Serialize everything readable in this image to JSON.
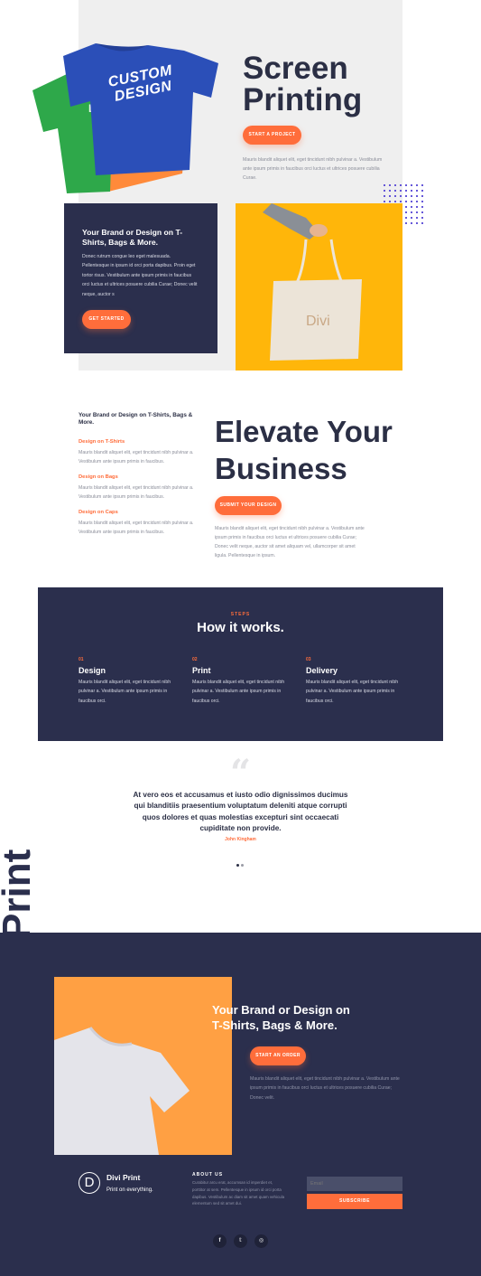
{
  "colors": {
    "navy": "#2b2f4d",
    "orange": "#ff6d3b",
    "yellow": "#ffb60a",
    "amber": "#ffa043",
    "light_gray": "#efefef",
    "purple_dots": "#5a4bd6"
  },
  "hero": {
    "title_line1": "Screen",
    "title_line2": "Printing",
    "button": "START A PROJECT",
    "text": "Mauris blandit aliquet elit, eget tincidunt nibh pulvinar a. Vestibulum ante ipsum primis in faucibus orci luctus et ultrices posuere cubilia Curae.",
    "tshirt_text": "CUSTOM DESIGN",
    "green_shirt_letter": "L"
  },
  "brand_card": {
    "title": "Your Brand or Design on T-Shirts, Bags & More.",
    "text": "Donec rutrum congue leo eget malesuada. Pellentesque in ipsum id orci porta dapibus. Proin eget tortor risus. Vestibulum ante ipsum primis in faucibus orci luctus et ultrices posuere cubilia Curae; Donec velit neque, auctor s",
    "button": "GET STARTED",
    "bag_text": "Divi"
  },
  "elevate": {
    "sidebar_title": "Your Brand or Design on T-Shirts, Bags & More.",
    "items": [
      {
        "title": "Design on T-Shirts",
        "text": "Mauris blandit aliquet elit, eget tincidunt nibh pulvinar a. Vestibulum ante ipsum primis in faucibus."
      },
      {
        "title": "Design on Bags",
        "text": "Mauris blandit aliquet elit, eget tincidunt nibh pulvinar a. Vestibulum ante ipsum primis in faucibus."
      },
      {
        "title": "Design on Caps",
        "text": "Mauris blandit aliquet elit, eget tincidunt nibh pulvinar a. Vestibulum ante ipsum primis in faucibus."
      }
    ],
    "title_line1": "Elevate Your",
    "title_line2": "Business",
    "button": "SUBMIT YOUR DESIGN",
    "text": "Mauris blandit aliquet elit, eget tincidunt nibh pulvinar a. Vestibulum ante ipsum primis in faucibus orci luctus et ultrices posuere cubilia Curae; Donec velit neque, auctor sit amet aliquam vel, ullamcorper sit amet ligula. Pellentesque in ipsum."
  },
  "steps": {
    "eyebrow": "STEPS",
    "title": "How it works.",
    "items": [
      {
        "num": "01",
        "title": "Design",
        "text": "Mauris blandit aliquet elit, eget tincidunt nibh pulvinar a. Vestibulum ante ipsum primis in faucibus orci."
      },
      {
        "num": "02",
        "title": "Print",
        "text": "Mauris blandit aliquet elit, eget tincidunt nibh pulvinar a. Vestibulum ante ipsum primis in faucibus orci."
      },
      {
        "num": "03",
        "title": "Delivery",
        "text": "Mauris blandit aliquet elit, eget tincidunt nibh pulvinar a. Vestibulum ante ipsum primis in faucibus orci."
      }
    ]
  },
  "testimonial": {
    "quote_mark": "“",
    "text": "At vero eos et accusamus et iusto odio dignissimos ducimus qui blanditiis praesentium voluptatum deleniti atque corrupti quos dolores et quas molestias excepturi sint occaecati cupiditate non provide.",
    "author": "John Kingham",
    "dots": 2,
    "active_dot": 0
  },
  "vertical_word": "Print",
  "cta": {
    "title_line1": "Your Brand or Design on",
    "title_line2": "T-Shirts, Bags & More.",
    "button": "START AN ORDER",
    "text": "Mauris blandit aliquet elit, eget tincidunt nibh pulvinar a. Vestibulum ante ipsum primis in faucibus orci luctus et ultrices posuere cubilia Curae; Donec velit."
  },
  "footer": {
    "logo_letter": "D",
    "brand": "Divi Print",
    "tagline": "Print on everything.",
    "about_title": "ABOUT US",
    "about_text": "Curabitur arcu erat, accumsan id imperdiet et, porttitor at sem. Pellentesque in ipsum id orci porta dapibus. Vestibulum ac diam sit amet quam vehicula elementum sed sit amet dui.",
    "email_placeholder": "Email",
    "subscribe": "SUBSCRIBE",
    "social": [
      {
        "icon": "facebook-icon",
        "glyph": "f"
      },
      {
        "icon": "twitter-icon",
        "glyph": "𝕥"
      },
      {
        "icon": "instagram-icon",
        "glyph": "◎"
      }
    ]
  }
}
